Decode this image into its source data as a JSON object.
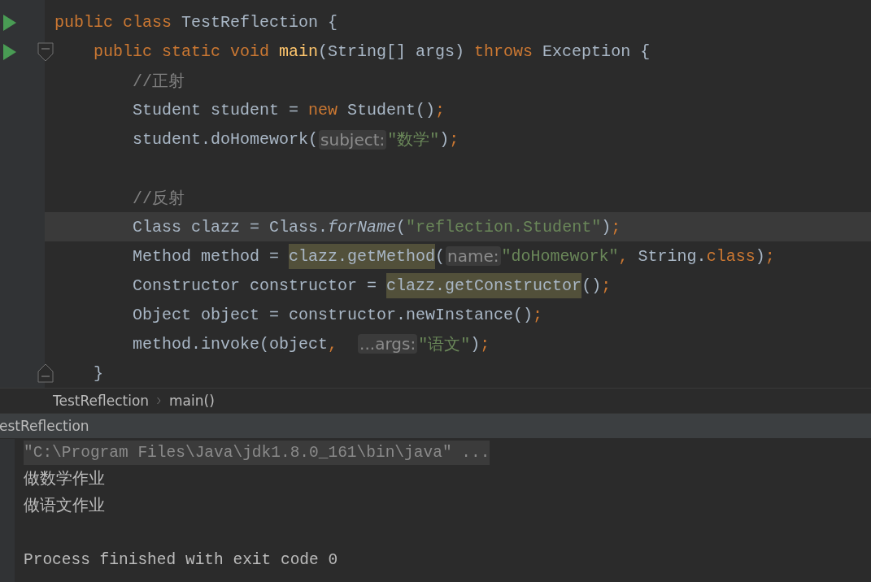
{
  "editor": {
    "lines": [
      {
        "kind": "code",
        "run": true,
        "current": false,
        "tokens": [
          {
            "kind": "keyword",
            "text": "public class"
          },
          {
            "kind": "plain",
            "text": " TestReflection {"
          }
        ]
      },
      {
        "kind": "fold_start",
        "run": true,
        "current": false,
        "tokens": [
          {
            "kind": "keyword",
            "text": "    public static void"
          },
          {
            "kind": "method",
            "text": " main"
          },
          {
            "kind": "plain",
            "text": "(String[] args) "
          },
          {
            "kind": "keyword",
            "text": "throws"
          },
          {
            "kind": "plain",
            "text": " Exception {"
          }
        ]
      },
      {
        "kind": "code",
        "run": false,
        "current": false,
        "tokens": [
          {
            "kind": "comment",
            "text": "        //正射"
          }
        ]
      },
      {
        "kind": "code",
        "run": false,
        "current": false,
        "tokens": [
          {
            "kind": "plain",
            "text": "        Student student = "
          },
          {
            "kind": "keyword",
            "text": "new"
          },
          {
            "kind": "plain",
            "text": " Student()"
          },
          {
            "kind": "keyword",
            "text": ";"
          }
        ]
      },
      {
        "kind": "code",
        "run": false,
        "current": false,
        "tokens": [
          {
            "kind": "plain",
            "text": "        student.doHomework("
          },
          {
            "kind": "hint",
            "text": "subject:"
          },
          {
            "kind": "string",
            "text": "\"数学\""
          },
          {
            "kind": "plain",
            "text": ")"
          },
          {
            "kind": "keyword",
            "text": ";"
          }
        ]
      },
      {
        "kind": "code",
        "run": false,
        "current": false
      },
      {
        "kind": "code",
        "run": false,
        "current": false,
        "tokens": [
          {
            "kind": "comment",
            "text": "        //反射"
          }
        ]
      },
      {
        "kind": "code",
        "run": false,
        "current": true,
        "tokens": [
          {
            "kind": "plain",
            "text": "        Class clazz = Class."
          },
          {
            "kind": "italic",
            "text": "forName"
          },
          {
            "kind": "plain",
            "text": "("
          },
          {
            "kind": "string",
            "text": "\"reflection.Student\""
          },
          {
            "kind": "plain",
            "text": ")"
          },
          {
            "kind": "keyword",
            "text": ";"
          }
        ]
      },
      {
        "kind": "code",
        "run": false,
        "current": false,
        "tokens": [
          {
            "kind": "plain",
            "text": "        Method method = "
          },
          {
            "kind": "highlight",
            "text": "clazz.getMethod"
          },
          {
            "kind": "plain",
            "text": "("
          },
          {
            "kind": "hint",
            "text": "name:"
          },
          {
            "kind": "string",
            "text": "\"doHomework\""
          },
          {
            "kind": "keyword",
            "text": ", "
          },
          {
            "kind": "plain",
            "text": "String."
          },
          {
            "kind": "keyword",
            "text": "class"
          },
          {
            "kind": "plain",
            "text": ")"
          },
          {
            "kind": "keyword",
            "text": ";"
          }
        ]
      },
      {
        "kind": "code",
        "run": false,
        "current": false,
        "tokens": [
          {
            "kind": "plain",
            "text": "        Constructor constructor = "
          },
          {
            "kind": "highlight",
            "text": "clazz.getConstructor"
          },
          {
            "kind": "plain",
            "text": "()"
          },
          {
            "kind": "keyword",
            "text": ";"
          }
        ]
      },
      {
        "kind": "code",
        "run": false,
        "current": false,
        "tokens": [
          {
            "kind": "plain",
            "text": "        Object object = constructor.newInstance()"
          },
          {
            "kind": "keyword",
            "text": ";"
          }
        ]
      },
      {
        "kind": "code",
        "run": false,
        "current": false,
        "tokens": [
          {
            "kind": "plain",
            "text": "        method.invoke(object"
          },
          {
            "kind": "keyword",
            "text": ",  "
          },
          {
            "kind": "hint",
            "text": "...args:"
          },
          {
            "kind": "string",
            "text": "\"语文\""
          },
          {
            "kind": "plain",
            "text": ")"
          },
          {
            "kind": "keyword",
            "text": ";"
          }
        ]
      },
      {
        "kind": "fold_end",
        "run": false,
        "current": false,
        "tokens": [
          {
            "kind": "plain",
            "text": "    }"
          }
        ]
      }
    ]
  },
  "breadcrumb": [
    "TestReflection",
    "main()"
  ],
  "console": {
    "title": "estReflection",
    "lines": [
      {
        "kind": "command",
        "text": "\"C:\\Program Files\\Java\\jdk1.8.0_161\\bin\\java\" ..."
      },
      {
        "kind": "output",
        "text": "做数学作业"
      },
      {
        "kind": "output",
        "text": "做语文作业"
      },
      {
        "kind": "exit",
        "text": "Process finished with exit code 0"
      }
    ]
  }
}
